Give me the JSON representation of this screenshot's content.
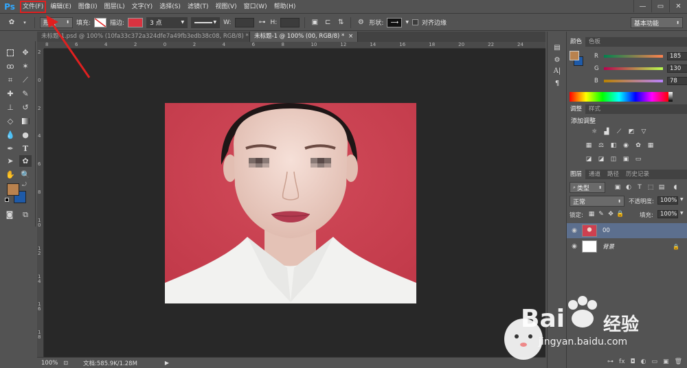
{
  "app": {
    "logo": "Ps",
    "accent_color": "#31a8ff",
    "highlight_color": "#e02020"
  },
  "menu": {
    "items": [
      "文件(F)",
      "编辑(E)",
      "图像(I)",
      "图层(L)",
      "文字(Y)",
      "选择(S)",
      "滤镜(T)",
      "视图(V)",
      "窗口(W)",
      "帮助(H)"
    ]
  },
  "window_controls": {
    "minimize": "—",
    "restore": "▭",
    "close": "✕"
  },
  "options": {
    "mode": "形状",
    "fill_label": "填充:",
    "stroke_label": "描边:",
    "stroke_color": "#d93340",
    "stroke_width": "3 点",
    "w_label": "W:",
    "h_label": "H:",
    "shape_label": "形状:",
    "align_edges": "对齐边缘",
    "workspace": "基本功能"
  },
  "tabs": [
    {
      "label": "未标题-1.psd @ 100% (10fa33c372a324dfe7a49fb3edb38c08, RGB/8) *",
      "close": "×"
    },
    {
      "label": "未标题-1 @ 100% (00, RGB/8) *",
      "close": "×"
    }
  ],
  "ruler": {
    "h_ticks": [
      "8",
      "6",
      "4",
      "2",
      "0",
      "2",
      "4",
      "6",
      "8",
      "10",
      "12",
      "14",
      "16",
      "18",
      "20",
      "22",
      "24"
    ],
    "v_ticks": [
      "2",
      "0",
      "2",
      "4",
      "6",
      "8",
      "1\n0",
      "1\n2",
      "1\n4",
      "1\n6",
      "1\n8"
    ]
  },
  "status": {
    "zoom": "100%",
    "doc": "文档:585.9K/1.28M"
  },
  "color_panel": {
    "tabs": [
      "颜色",
      "色板"
    ],
    "foreground": "#b9824e",
    "background": "#1e5aa8",
    "r_label": "R",
    "r": "185",
    "g_label": "G",
    "g": "130",
    "b_label": "B",
    "b": "78"
  },
  "adjust_panel": {
    "tabs": [
      "调整",
      "样式"
    ],
    "heading": "添加调整"
  },
  "layers_panel": {
    "tabs": [
      "图层",
      "通道",
      "路径",
      "历史记录"
    ],
    "filter": "类型",
    "blend_mode": "正常",
    "opacity_label": "不透明度:",
    "opacity": "100%",
    "lock_label": "锁定:",
    "fill_label": "填充:",
    "fill": "100%",
    "layers": [
      {
        "name": "00",
        "selected": true
      },
      {
        "name": "背景",
        "selected": false
      }
    ]
  },
  "watermark": {
    "brand": "Bai",
    "brand_cn": "经验",
    "url": "jingyan.baidu.com"
  }
}
